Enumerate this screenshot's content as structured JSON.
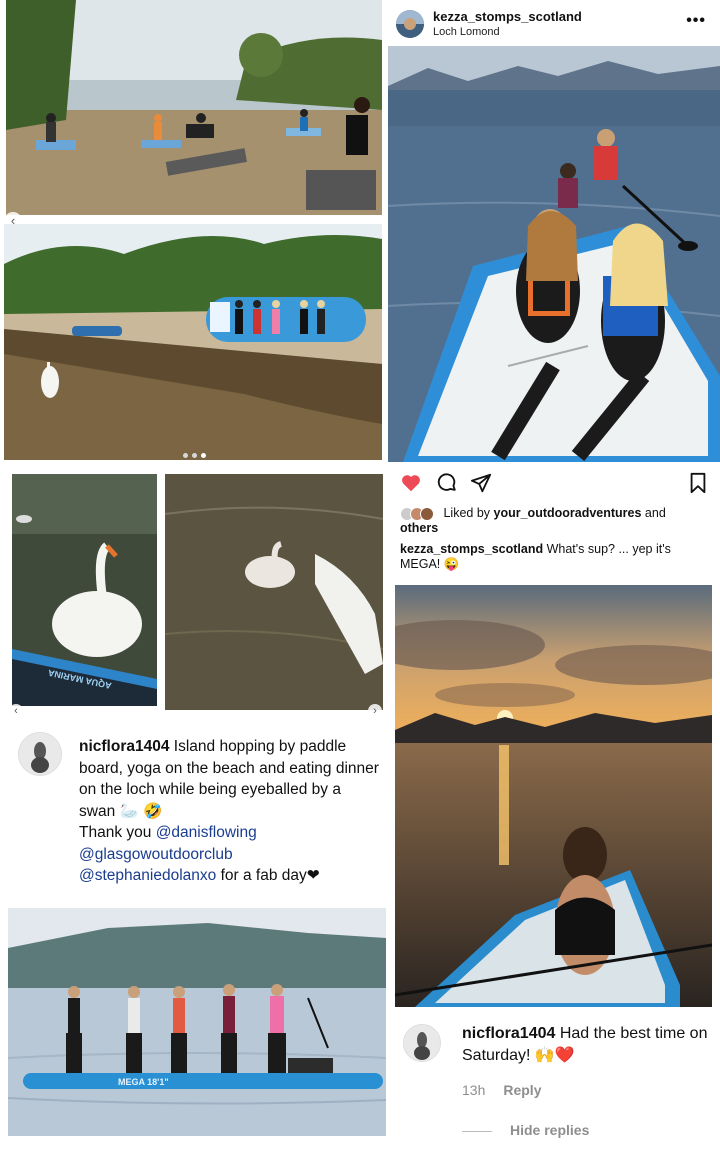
{
  "ig_post": {
    "username": "kezza_stomps_scotland",
    "location": "Loch Lomond",
    "more_icon": "•••",
    "liked_by_prefix": "Liked by ",
    "liked_by_user": "your_outdooradventures",
    "liked_by_and": " and",
    "liked_by_others": "others",
    "caption_user": "kezza_stomps_scotland",
    "caption_text": " What's sup? ... yep it's MEGA! 😜"
  },
  "board_text": "AQUA MARINA",
  "nic_post": {
    "username": "nicflora1404",
    "text_1": " Island hopping by paddle board, yoga on the beach and eating dinner on the loch while being eyeballed by a swan 🦢 🤣",
    "thank_you": "Thank you ",
    "mention_1": "@danisflowing",
    "mention_2": "@glasgowoutdoorclub",
    "mention_3": "@stephaniedolanxo",
    "closing": " for a fab day❤"
  },
  "comment": {
    "username": "nicflora1404",
    "text": " Had the best time on Saturday! 🙌❤️",
    "time": "13h",
    "reply_label": "Reply",
    "hide_replies_label": "Hide replies"
  },
  "mega_board_text": "MEGA 18'1\"",
  "colors": {
    "heart": "#ed4956",
    "mention": "#1a3d8f",
    "meta_gray": "#8e8e8e",
    "board_blue": "#3a9ad9"
  },
  "icons": [
    "heart-icon",
    "comment-icon",
    "share-icon",
    "bookmark-icon",
    "more-icon",
    "chevron-left-icon",
    "chevron-right-icon"
  ]
}
